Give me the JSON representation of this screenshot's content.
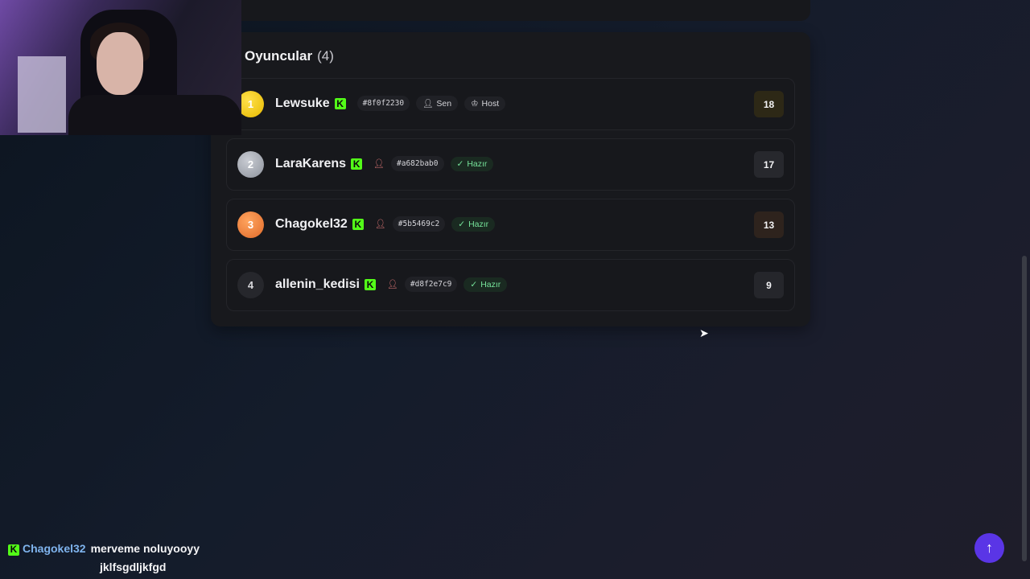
{
  "players_panel": {
    "title": "Oyuncular",
    "count": "(4)"
  },
  "players": [
    {
      "rank": "1",
      "name": "Lewsuke",
      "id_tag": "#8f0f2230",
      "badges": [
        "Sen",
        "Host"
      ],
      "score": "18"
    },
    {
      "rank": "2",
      "name": "LaraKarens",
      "id_tag": "#a682bab0",
      "status": "Hazır",
      "score": "17"
    },
    {
      "rank": "3",
      "name": "Chagokel32",
      "id_tag": "#5b5469c2",
      "status": "Hazır",
      "score": "13"
    },
    {
      "rank": "4",
      "name": "allenin_kedisi",
      "id_tag": "#d8f2e7c9",
      "status": "Hazır",
      "score": "9"
    }
  ],
  "chat": {
    "user": "Chagokel32",
    "message_line1": "merveme noluyooyy",
    "message_line2": "jklfsgdljkfgd"
  },
  "icons": {
    "kick": "K",
    "scroll_top": "↑",
    "cursor": "➤"
  },
  "colors": {
    "kick_green": "#53fc18",
    "fab": "#5a35e6",
    "ready": "#76e39a"
  }
}
